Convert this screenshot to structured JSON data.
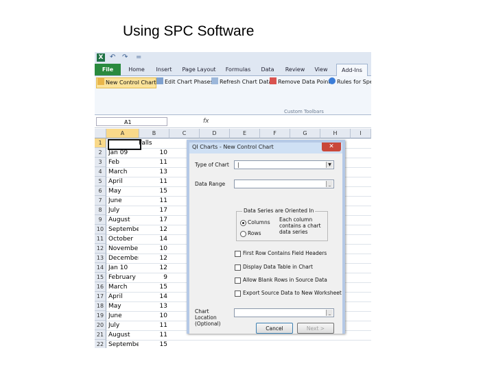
{
  "slide": {
    "title": "Using SPC Software"
  },
  "excel": {
    "quick_access": {
      "undo": "↶",
      "redo": "↷",
      "customize": "="
    },
    "tabs": [
      "File",
      "Home",
      "Insert",
      "Page Layout",
      "Formulas",
      "Data",
      "Review",
      "View",
      "Add-Ins"
    ],
    "toolbar": {
      "buttons": [
        "New Control Chart",
        "Edit Chart Phases",
        "Refresh Chart Data",
        "Remove Data Point",
        "Rules for Spe"
      ],
      "group_label": "Custom Toolbars"
    },
    "name_box": "A1",
    "fx": "fx",
    "columns": [
      "A",
      "B",
      "C",
      "D",
      "E",
      "F",
      "G",
      "H",
      "I"
    ],
    "header_cell_b1": "Falls",
    "rows": [
      {
        "n": "1",
        "a": "",
        "b": ""
      },
      {
        "n": "2",
        "a": "Jan 09",
        "b": "10"
      },
      {
        "n": "3",
        "a": "Feb",
        "b": "11"
      },
      {
        "n": "4",
        "a": "March",
        "b": "13"
      },
      {
        "n": "5",
        "a": "April",
        "b": "11"
      },
      {
        "n": "6",
        "a": "May",
        "b": "15"
      },
      {
        "n": "7",
        "a": "June",
        "b": "11"
      },
      {
        "n": "8",
        "a": "July",
        "b": "17"
      },
      {
        "n": "9",
        "a": "August",
        "b": "17"
      },
      {
        "n": "10",
        "a": "Septembe",
        "b": "12"
      },
      {
        "n": "11",
        "a": "October",
        "b": "14"
      },
      {
        "n": "12",
        "a": "Novembe",
        "b": "10"
      },
      {
        "n": "13",
        "a": "December",
        "b": "12"
      },
      {
        "n": "14",
        "a": "Jan 10",
        "b": "12"
      },
      {
        "n": "15",
        "a": "February",
        "b": "9"
      },
      {
        "n": "16",
        "a": "March",
        "b": "15"
      },
      {
        "n": "17",
        "a": "April",
        "b": "14"
      },
      {
        "n": "18",
        "a": "May",
        "b": "13"
      },
      {
        "n": "19",
        "a": "June",
        "b": "10"
      },
      {
        "n": "20",
        "a": "July",
        "b": "11"
      },
      {
        "n": "21",
        "a": "August",
        "b": "11"
      },
      {
        "n": "22",
        "a": "Septembe",
        "b": "15"
      }
    ]
  },
  "dialog": {
    "title": "QI Charts - New Control Chart",
    "close": "✕",
    "type_label": "Type of Chart",
    "type_value": "|",
    "range_label": "Data Range",
    "range_value": "",
    "orientation_legend": "Data Series are Oriented In",
    "radio_columns": "Columns",
    "radio_rows": "Rows",
    "orientation_hint": "Each column contains a chart data series",
    "checkboxes": [
      "First Row Contains Field Headers",
      "Display Data Table in Chart",
      "Allow Blank Rows in Source Data",
      "Export Source Data to New Worksheet"
    ],
    "location_label": "Chart Location (Optional)",
    "location_value": "",
    "cancel": "Cancel",
    "next": "Next >"
  },
  "colors": {
    "file_tab": "#2a8a3e",
    "selection": "#fbe39a",
    "dialog_border": "#b5c9e6",
    "close_button": "#c9473a"
  }
}
